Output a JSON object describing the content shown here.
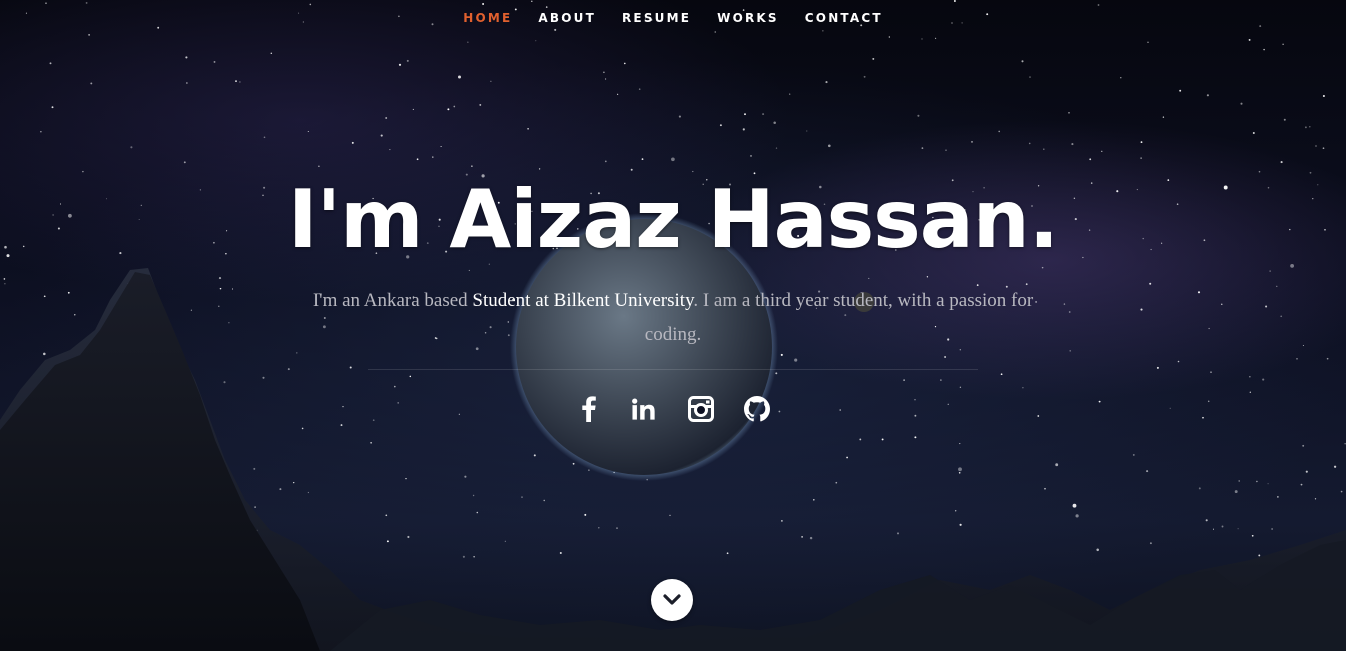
{
  "nav": {
    "items": [
      {
        "label": "HOME",
        "active": true
      },
      {
        "label": "ABOUT",
        "active": false
      },
      {
        "label": "RESUME",
        "active": false
      },
      {
        "label": "WORKS",
        "active": false
      },
      {
        "label": "CONTACT",
        "active": false
      }
    ],
    "active_color": "#e0602e"
  },
  "banner": {
    "headline": "I'm Aizaz Hassan.",
    "intro_before": "I'm an Ankara based ",
    "intro_highlight": "Student at Bilkent University",
    "intro_after": ". I am a third year student, with a passion for coding."
  },
  "social": [
    {
      "icon": "facebook-icon"
    },
    {
      "icon": "linkedin-icon"
    },
    {
      "icon": "instagram-icon"
    },
    {
      "icon": "github-icon"
    }
  ],
  "scroll_down": {
    "icon": "chevron-down-icon"
  }
}
